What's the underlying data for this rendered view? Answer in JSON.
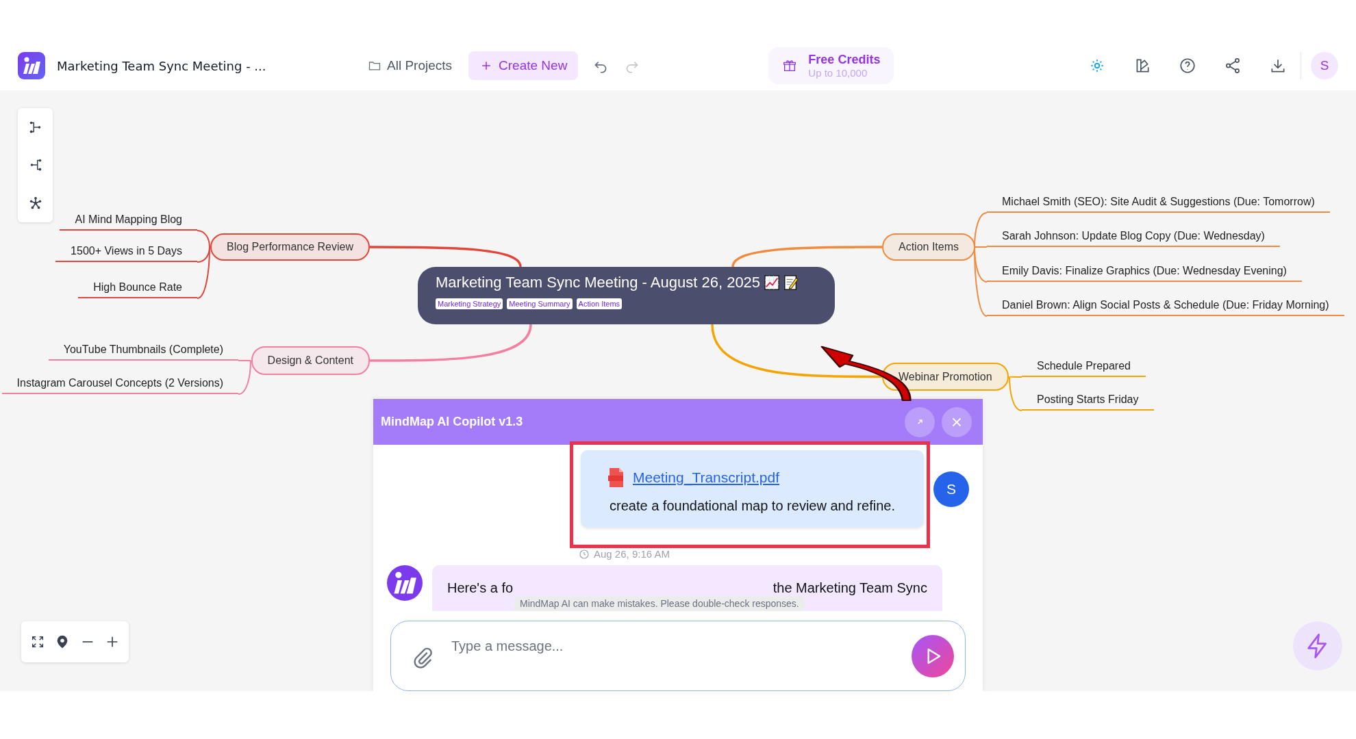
{
  "app": {
    "title": "Marketing Team Sync Meeting - ..."
  },
  "toolbar": {
    "all_projects": "All Projects",
    "create_new": "Create New"
  },
  "credits": {
    "title": "Free Credits",
    "subtitle": "Up to 10,000"
  },
  "user": {
    "initial": "S"
  },
  "mindmap": {
    "root": {
      "title": "Marketing Team Sync Meeting - August 26, 2025",
      "tags": [
        "Marketing Strategy",
        "Meeting Summary",
        "Action Items"
      ]
    },
    "branches": [
      {
        "label": "Blog Performance Review",
        "color": "#e0463a",
        "children": [
          {
            "label": "AI Mind Mapping Blog"
          },
          {
            "label": "1500+ Views in 5 Days"
          },
          {
            "label": "High Bounce Rate"
          }
        ]
      },
      {
        "label": "Design & Content",
        "color": "#f47fa0",
        "children": [
          {
            "label": "YouTube Thumbnails (Complete)"
          },
          {
            "label": "Instagram Carousel Concepts (2 Versions)"
          }
        ]
      },
      {
        "label": "Action Items",
        "color": "#f08a3e",
        "children": [
          {
            "label": "Michael Smith (SEO): Site Audit & Suggestions (Due: Tomorrow)"
          },
          {
            "label": "Sarah Johnson: Update Blog Copy (Due: Wednesday)"
          },
          {
            "label": "Emily Davis: Finalize Graphics (Due: Wednesday Evening)"
          },
          {
            "label": "Daniel Brown: Align Social Posts & Schedule (Due: Friday Morning)"
          }
        ]
      },
      {
        "label": "Webinar Promotion",
        "color": "#f5a300",
        "children": [
          {
            "label": "Schedule Prepared"
          },
          {
            "label": "Posting Starts Friday"
          }
        ]
      }
    ]
  },
  "chat": {
    "title": "MindMap AI Copilot v1.3",
    "user_message": {
      "attachment": "Meeting_Transcript.pdf",
      "text": "create a foundational map to review and refine.",
      "time": "Aug 26, 9:16 AM",
      "avatar": "S"
    },
    "assistant_message": {
      "text_start": "Here's a fo",
      "text_end": "the Marketing Team Sync"
    },
    "disclaimer": "MindMap AI can make mistakes. Please double-check responses.",
    "input": {
      "placeholder": "Type a message..."
    }
  }
}
